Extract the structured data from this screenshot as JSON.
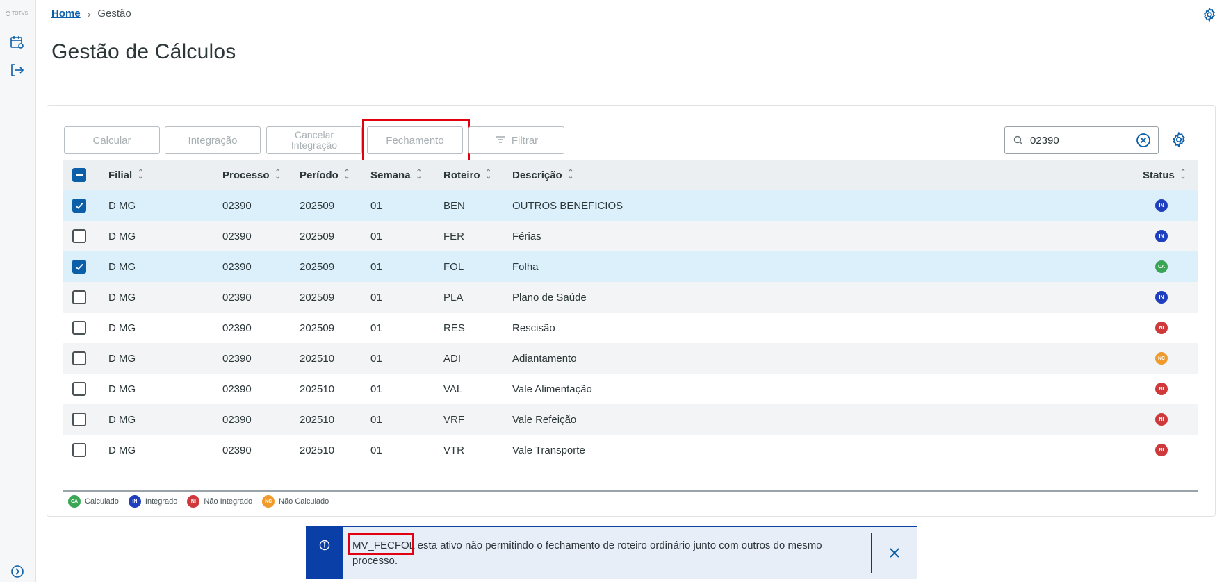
{
  "sidebar": {
    "logo_text": "TOTVS",
    "icons": [
      "calendar-settings-icon",
      "exit-icon",
      "expand-icon"
    ]
  },
  "breadcrumb": {
    "home": "Home",
    "current": "Gestão"
  },
  "page_title": "Gestão de Cálculos",
  "toolbar": {
    "calcular": "Calcular",
    "integracao": "Integração",
    "cancelar_line1": "Cancelar",
    "cancelar_line2": "Integração",
    "fechamento": "Fechamento",
    "filtrar": "Filtrar"
  },
  "search": {
    "value": "02390"
  },
  "table": {
    "headers": {
      "filial": "Filial",
      "processo": "Processo",
      "periodo": "Período",
      "semana": "Semana",
      "roteiro": "Roteiro",
      "descricao": "Descrição",
      "status": "Status"
    },
    "rows": [
      {
        "filial": "D MG",
        "processo": "02390",
        "periodo": "202509",
        "semana": "01",
        "roteiro": "BEN",
        "descricao": "OUTROS BENEFICIOS",
        "status": "IN",
        "checked": true
      },
      {
        "filial": "D MG",
        "processo": "02390",
        "periodo": "202509",
        "semana": "01",
        "roteiro": "FER",
        "descricao": "Férias",
        "status": "IN",
        "checked": false
      },
      {
        "filial": "D MG",
        "processo": "02390",
        "periodo": "202509",
        "semana": "01",
        "roteiro": "FOL",
        "descricao": "Folha",
        "status": "CA",
        "checked": true
      },
      {
        "filial": "D MG",
        "processo": "02390",
        "periodo": "202509",
        "semana": "01",
        "roteiro": "PLA",
        "descricao": "Plano de Saúde",
        "status": "IN",
        "checked": false
      },
      {
        "filial": "D MG",
        "processo": "02390",
        "periodo": "202509",
        "semana": "01",
        "roteiro": "RES",
        "descricao": "Rescisão",
        "status": "NI",
        "checked": false
      },
      {
        "filial": "D MG",
        "processo": "02390",
        "periodo": "202510",
        "semana": "01",
        "roteiro": "ADI",
        "descricao": "Adiantamento",
        "status": "NC",
        "checked": false
      },
      {
        "filial": "D MG",
        "processo": "02390",
        "periodo": "202510",
        "semana": "01",
        "roteiro": "VAL",
        "descricao": "Vale Alimentação",
        "status": "NI",
        "checked": false
      },
      {
        "filial": "D MG",
        "processo": "02390",
        "periodo": "202510",
        "semana": "01",
        "roteiro": "VRF",
        "descricao": "Vale Refeição",
        "status": "NI",
        "checked": false
      },
      {
        "filial": "D MG",
        "processo": "02390",
        "periodo": "202510",
        "semana": "01",
        "roteiro": "VTR",
        "descricao": "Vale Transporte",
        "status": "NI",
        "checked": false
      }
    ]
  },
  "status_colors": {
    "CA": "#3aa655",
    "IN": "#1f3fbf",
    "NI": "#d0393b",
    "NC": "#ef9a2a"
  },
  "legend": [
    {
      "code": "CA",
      "label": "Calculado"
    },
    {
      "code": "IN",
      "label": "Integrado"
    },
    {
      "code": "NI",
      "label": "Não Integrado"
    },
    {
      "code": "NC",
      "label": "Não Calculado"
    }
  ],
  "toast": {
    "highlight": "MV_FECFOL",
    "message": " esta ativo não permitindo o fechamento de roteiro ordinário junto com outros do mesmo processo."
  }
}
